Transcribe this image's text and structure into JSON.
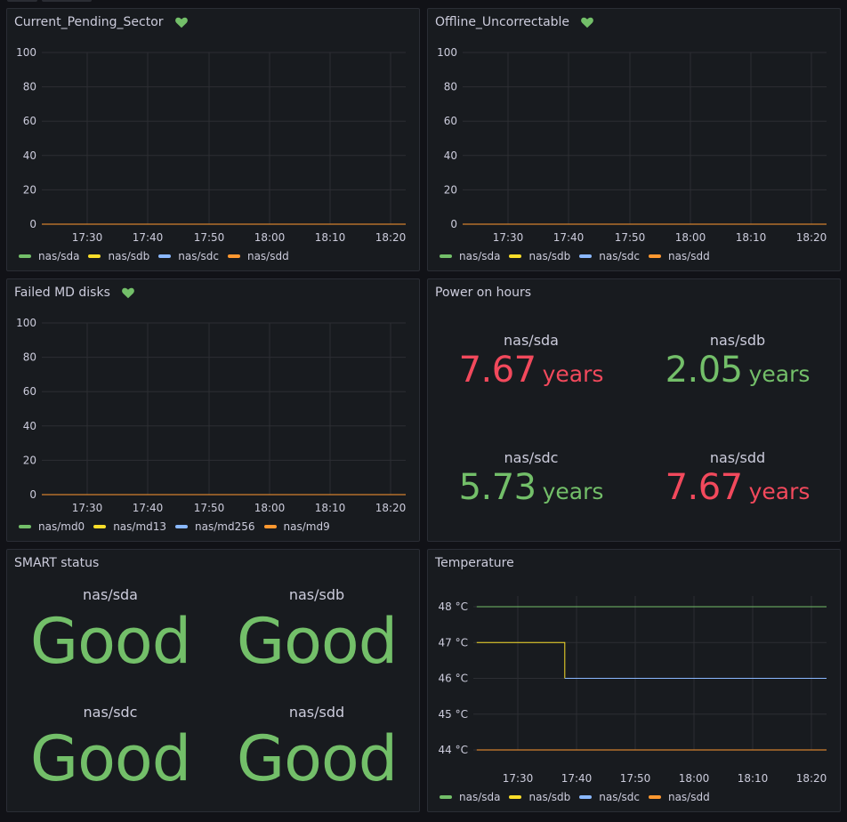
{
  "colors": {
    "sda": "#73bf69",
    "sdb": "#fade2a",
    "sdc": "#8ab8ff",
    "sdd": "#ff9830",
    "good": "#73bf69",
    "bad": "#f2495c",
    "health_icon": "#73bf69"
  },
  "time_ticks": [
    "17:30",
    "17:40",
    "17:50",
    "18:00",
    "18:10",
    "18:20"
  ],
  "panels": {
    "pending": {
      "title": "Current_Pending_Sector",
      "health_icon": "heart-icon",
      "y_ticks": [
        "100",
        "80",
        "60",
        "40",
        "20",
        "0"
      ],
      "legend": [
        "nas/sda",
        "nas/sdb",
        "nas/sdc",
        "nas/sdd"
      ]
    },
    "offline": {
      "title": "Offline_Uncorrectable",
      "health_icon": "heart-icon",
      "y_ticks": [
        "100",
        "80",
        "60",
        "40",
        "20",
        "0"
      ],
      "legend": [
        "nas/sda",
        "nas/sdb",
        "nas/sdc",
        "nas/sdd"
      ]
    },
    "failed_md": {
      "title": "Failed MD disks",
      "health_icon": "heart-icon",
      "y_ticks": [
        "100",
        "80",
        "60",
        "40",
        "20",
        "0"
      ],
      "legend": [
        "nas/md0",
        "nas/md13",
        "nas/md256",
        "nas/md9"
      ]
    },
    "power": {
      "title": "Power on hours",
      "items": [
        {
          "label": "nas/sda",
          "value": "7.67",
          "unit": "years",
          "status": "bad"
        },
        {
          "label": "nas/sdb",
          "value": "2.05",
          "unit": "years",
          "status": "good"
        },
        {
          "label": "nas/sdc",
          "value": "5.73",
          "unit": "years",
          "status": "good"
        },
        {
          "label": "nas/sdd",
          "value": "7.67",
          "unit": "years",
          "status": "bad"
        }
      ]
    },
    "smart": {
      "title": "SMART status",
      "items": [
        {
          "label": "nas/sda",
          "value": "Good"
        },
        {
          "label": "nas/sdb",
          "value": "Good"
        },
        {
          "label": "nas/sdc",
          "value": "Good"
        },
        {
          "label": "nas/sdd",
          "value": "Good"
        }
      ]
    },
    "temperature": {
      "title": "Temperature",
      "y_ticks": [
        "48 °C",
        "47 °C",
        "46 °C",
        "45 °C",
        "44 °C"
      ],
      "legend": [
        "nas/sda",
        "nas/sdb",
        "nas/sdc",
        "nas/sdd"
      ]
    }
  },
  "chart_data": [
    {
      "type": "line",
      "title": "Current_Pending_Sector",
      "x": [
        "17:30",
        "17:40",
        "17:50",
        "18:00",
        "18:10",
        "18:20"
      ],
      "ylim": [
        0,
        100
      ],
      "grid": true,
      "legend_position": "bottom-left",
      "series": [
        {
          "name": "nas/sda",
          "values": [
            0,
            0,
            0,
            0,
            0,
            0
          ]
        },
        {
          "name": "nas/sdb",
          "values": [
            0,
            0,
            0,
            0,
            0,
            0
          ]
        },
        {
          "name": "nas/sdc",
          "values": [
            0,
            0,
            0,
            0,
            0,
            0
          ]
        },
        {
          "name": "nas/sdd",
          "values": [
            0,
            0,
            0,
            0,
            0,
            0
          ]
        }
      ]
    },
    {
      "type": "line",
      "title": "Offline_Uncorrectable",
      "x": [
        "17:30",
        "17:40",
        "17:50",
        "18:00",
        "18:10",
        "18:20"
      ],
      "ylim": [
        0,
        100
      ],
      "grid": true,
      "legend_position": "bottom-left",
      "series": [
        {
          "name": "nas/sda",
          "values": [
            0,
            0,
            0,
            0,
            0,
            0
          ]
        },
        {
          "name": "nas/sdb",
          "values": [
            0,
            0,
            0,
            0,
            0,
            0
          ]
        },
        {
          "name": "nas/sdc",
          "values": [
            0,
            0,
            0,
            0,
            0,
            0
          ]
        },
        {
          "name": "nas/sdd",
          "values": [
            0,
            0,
            0,
            0,
            0,
            0
          ]
        }
      ]
    },
    {
      "type": "line",
      "title": "Failed MD disks",
      "x": [
        "17:30",
        "17:40",
        "17:50",
        "18:00",
        "18:10",
        "18:20"
      ],
      "ylim": [
        0,
        100
      ],
      "grid": true,
      "legend_position": "bottom-left",
      "series": [
        {
          "name": "nas/md0",
          "values": [
            0,
            0,
            0,
            0,
            0,
            0
          ]
        },
        {
          "name": "nas/md13",
          "values": [
            0,
            0,
            0,
            0,
            0,
            0
          ]
        },
        {
          "name": "nas/md256",
          "values": [
            0,
            0,
            0,
            0,
            0,
            0
          ]
        },
        {
          "name": "nas/md9",
          "values": [
            0,
            0,
            0,
            0,
            0,
            0
          ]
        }
      ]
    },
    {
      "type": "line",
      "title": "Temperature",
      "ylabel_unit": "°C",
      "ylim": [
        44,
        48
      ],
      "grid": true,
      "legend_position": "bottom-left",
      "x_ticks": [
        "17:30",
        "17:40",
        "17:50",
        "18:00",
        "18:10",
        "18:20"
      ],
      "series": [
        {
          "name": "nas/sda",
          "points": [
            [
              "17:23",
              48
            ],
            [
              "18:23",
              48
            ]
          ]
        },
        {
          "name": "nas/sdb",
          "points": [
            [
              "17:23",
              47
            ],
            [
              "17:38",
              47
            ],
            [
              "17:38",
              46
            ]
          ]
        },
        {
          "name": "nas/sdc",
          "points": [
            [
              "17:38",
              46
            ],
            [
              "18:23",
              46
            ]
          ]
        },
        {
          "name": "nas/sdd",
          "points": [
            [
              "17:23",
              44
            ],
            [
              "18:23",
              44
            ]
          ]
        }
      ]
    }
  ]
}
